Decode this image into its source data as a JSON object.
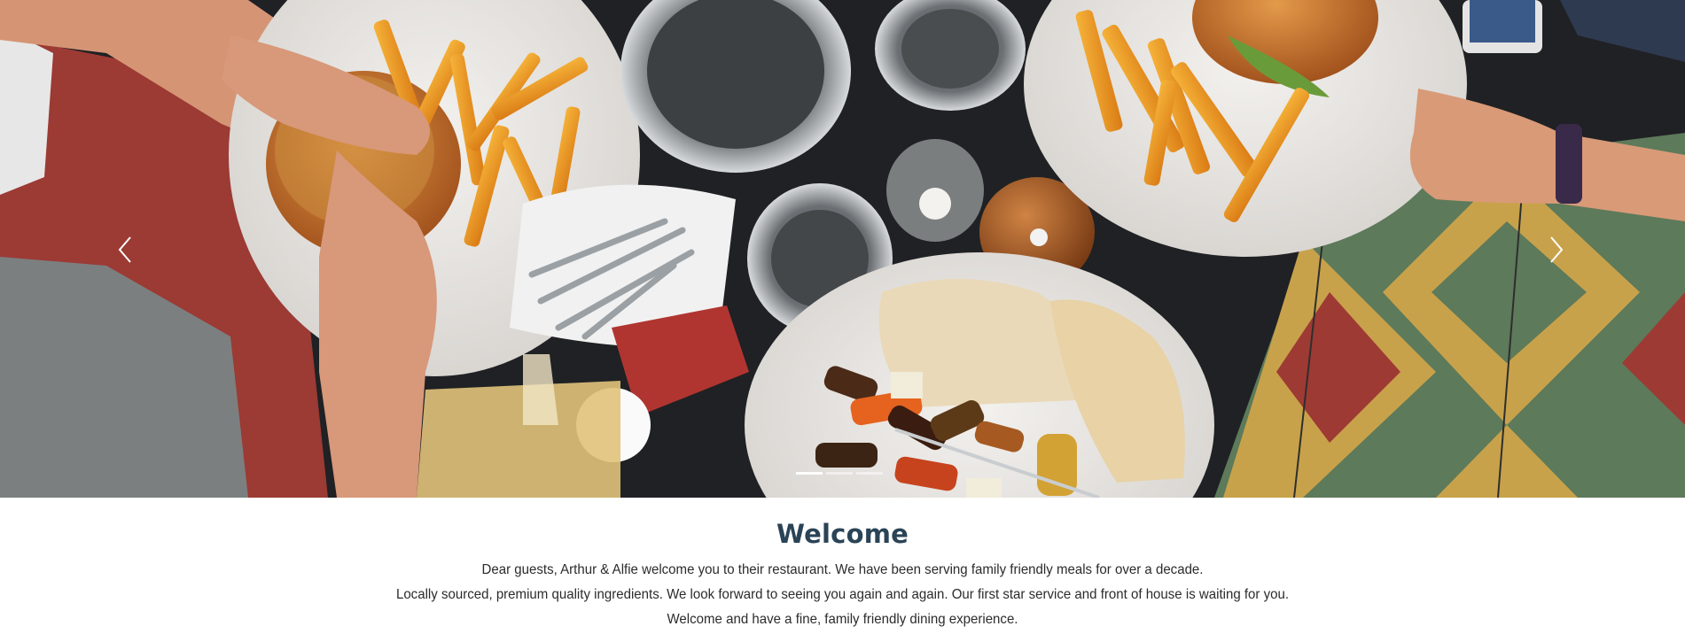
{
  "carousel": {
    "prev_label": "Previous",
    "next_label": "Next",
    "prev_icon": "chevron-left-icon",
    "next_icon": "chevron-right-icon",
    "slide_count": 3,
    "active_slide": 1,
    "image_subject": "restaurant-table-food-top-view"
  },
  "welcome": {
    "title": "Welcome",
    "lines": [
      "Dear guests, Arthur & Alfie welcome you to their restaurant. We have been serving family friendly meals for over a decade.",
      "Locally sourced, premium quality ingredients. We look forward to seeing you again and again. Our first star service and front of house is waiting for you.",
      "Welcome and have a fine, family friendly dining experience."
    ]
  },
  "colors": {
    "title": "#2a4356",
    "body_text": "#2b2b2b",
    "table_surface": "#1f2124"
  }
}
